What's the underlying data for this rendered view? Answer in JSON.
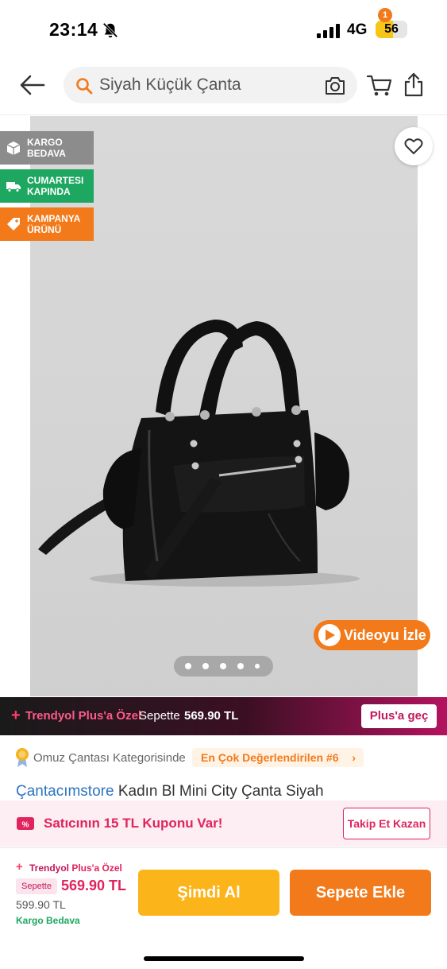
{
  "status_bar": {
    "time": "23:14",
    "network": "4G",
    "battery_level": "56",
    "battery_fraction": 0.56
  },
  "header": {
    "search_text": "Siyah Küçük Çanta",
    "cart_count": "1",
    "icons": [
      "back-arrow-icon",
      "search-icon",
      "camera-icon",
      "cart-icon",
      "share-icon"
    ]
  },
  "badges": [
    {
      "label": "KARGO BEDAVA",
      "color": "#8c8c8c",
      "icon": "box-icon"
    },
    {
      "label": "CUMARTESI KAPINDA",
      "color": "#1ea761",
      "icon": "truck-icon"
    },
    {
      "label": "KAMPANYA ÜRÜNÜ",
      "color": "#f27a1a",
      "icon": "tag-icon"
    }
  ],
  "gallery": {
    "video_label": "Videoyu İzle",
    "image_count": 5,
    "active_index": 0
  },
  "plus_banner": {
    "plus_sign": "+",
    "brand": "Trendyol Plus'a Özel",
    "sepette": "Sepette",
    "price": "569.90 TL",
    "button": "Plus'a geç"
  },
  "category": {
    "text": "Omuz Çantası Kategorisinde",
    "rank": "En Çok Değerlendirilen #6"
  },
  "product": {
    "store": "Çantacımstore",
    "name": "Kadın Bl Mini City Çanta Siyah"
  },
  "coupon": {
    "text": "Satıcının 15 TL Kuponu Var!",
    "button": "Takip Et Kazan"
  },
  "bottom": {
    "plus_sign": "+",
    "brand_a": "Trendyol ",
    "brand_b": "Plus'a Özel",
    "sepette": "Sepette",
    "price": "569.90 TL",
    "old_price": "599.90 TL",
    "shipping": "Kargo Bedava",
    "buy_now": "Şimdi Al",
    "add_to_cart": "Sepete Ekle"
  },
  "colors": {
    "brand_orange": "#f27a1a",
    "buy_yellow": "#fbb41a",
    "plus_pink": "#e0245e",
    "green": "#1ea761"
  }
}
